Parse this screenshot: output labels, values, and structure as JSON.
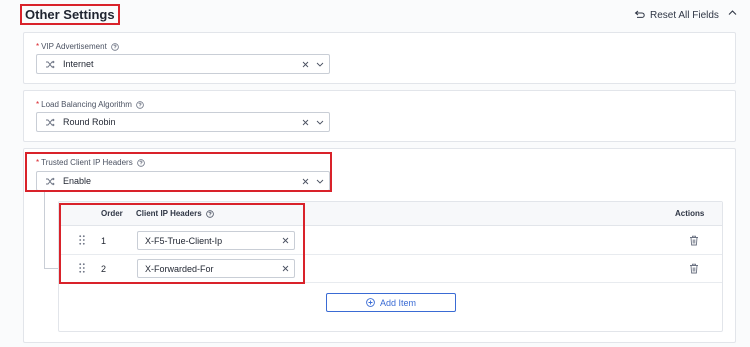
{
  "header": {
    "title": "Other Settings",
    "reset_label": "Reset All Fields"
  },
  "fields": [
    {
      "required_mark": "*",
      "label": "VIP Advertisement",
      "value": "Internet"
    },
    {
      "required_mark": "*",
      "label": "Load Balancing Algorithm",
      "value": "Round Robin"
    },
    {
      "required_mark": "*",
      "label": "Trusted Client IP Headers",
      "value": "Enable"
    }
  ],
  "headers_table": {
    "columns": {
      "order": "Order",
      "headers": "Client IP Headers",
      "actions": "Actions"
    },
    "rows": [
      {
        "order": "1",
        "value": "X-F5-True-Client-Ip"
      },
      {
        "order": "2",
        "value": "X-Forwarded-For"
      }
    ],
    "add_label": "Add Item"
  },
  "colors": {
    "accent": "#3a6bd4",
    "highlight": "#d9222a"
  },
  "icons": {
    "reset": "reset-icon",
    "collapse": "chevron-up-icon",
    "help": "help-circle-icon",
    "select_lead": "shuffle-icon",
    "clear": "close-icon",
    "dropdown": "chevron-down-icon",
    "drag": "drag-handle-icon",
    "delete": "trash-icon",
    "add": "plus-circle-icon"
  }
}
